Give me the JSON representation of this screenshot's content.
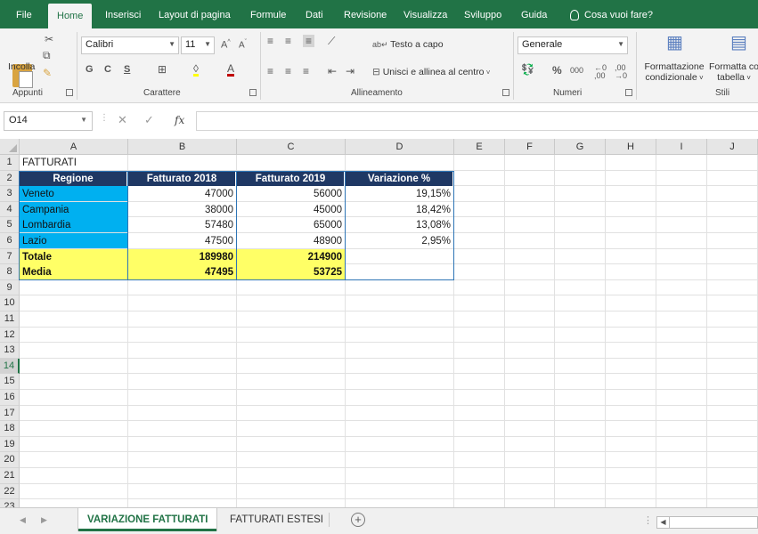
{
  "ribbon_tabs": [
    "File",
    "Home",
    "Inserisci",
    "Layout di pagina",
    "Formule",
    "Dati",
    "Revisione",
    "Visualizza",
    "Sviluppo",
    "Guida"
  ],
  "tell_me": "Cosa vuoi fare?",
  "clipboard": {
    "paste_label": "Incolla",
    "group": "Appunti"
  },
  "font": {
    "name": "Calibri",
    "size": "11",
    "bold": "G",
    "italic": "C",
    "underline": "S",
    "group": "Carattere"
  },
  "alignment": {
    "wrap": "Testo a capo",
    "merge": "Unisci e allinea al centro",
    "group": "Allineamento"
  },
  "number": {
    "format": "Generale",
    "percent": "%",
    "thousands": "000",
    "group": "Numeri"
  },
  "styles": {
    "conditional_1": "Formattazione",
    "conditional_2": "condizionale",
    "table_1": "Formatta co",
    "table_2": "tabella",
    "group": "Stili"
  },
  "name_box": "O14",
  "columns": [
    "A",
    "B",
    "C",
    "D",
    "E",
    "F",
    "G",
    "H",
    "I",
    "J"
  ],
  "rows": [
    "1",
    "2",
    "3",
    "4",
    "5",
    "6",
    "7",
    "8",
    "9",
    "10",
    "11",
    "12",
    "13",
    "14",
    "15",
    "16",
    "17",
    "18",
    "19",
    "20",
    "21",
    "22",
    "23"
  ],
  "sheet": {
    "title": "FATTURATI",
    "headers": [
      "Regione",
      "Fatturato 2018",
      "Fatturato 2019",
      "Variazione %"
    ],
    "data": [
      [
        "Veneto",
        "47000",
        "56000",
        "19,15%"
      ],
      [
        "Campania",
        "38000",
        "45000",
        "18,42%"
      ],
      [
        "Lombardia",
        "57480",
        "65000",
        "13,08%"
      ],
      [
        "Lazio",
        "47500",
        "48900",
        "2,95%"
      ]
    ],
    "totals": [
      [
        "Totale",
        "189980",
        "214900"
      ],
      [
        "Media",
        "47495",
        "53725"
      ]
    ]
  },
  "sheet_tabs": [
    "VARIAZIONE FATTURATI",
    "FATTURATI ESTESI"
  ],
  "colors": {
    "accent": "#217346",
    "header_fill": "#1f3864",
    "region_fill": "#00b0f0",
    "total_fill": "#ffff66"
  }
}
